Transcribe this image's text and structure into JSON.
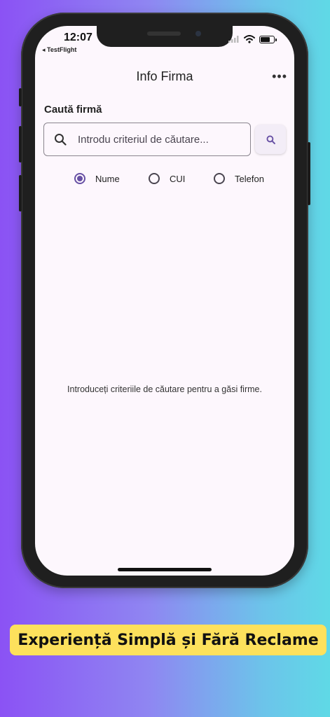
{
  "status_bar": {
    "time": "12:07",
    "back_app": "◂ TestFlight"
  },
  "header": {
    "title": "Info Firma",
    "more_icon": "more-horizontal-icon"
  },
  "search": {
    "section_label": "Caută firmă",
    "placeholder": "Introdu criteriul de căutare...",
    "value": ""
  },
  "search_type": {
    "options": [
      {
        "label": "Nume",
        "selected": true
      },
      {
        "label": "CUI",
        "selected": false
      },
      {
        "label": "Telefon",
        "selected": false
      }
    ]
  },
  "empty_state": {
    "message": "Introduceți criteriile de căutare pentru a găsi firme."
  },
  "banner": {
    "text": "Experiență Simplă și Fără Reclame"
  },
  "colors": {
    "accent": "#6750a4",
    "screen_bg": "#fdf7fd",
    "banner_bg": "#fde15c"
  }
}
